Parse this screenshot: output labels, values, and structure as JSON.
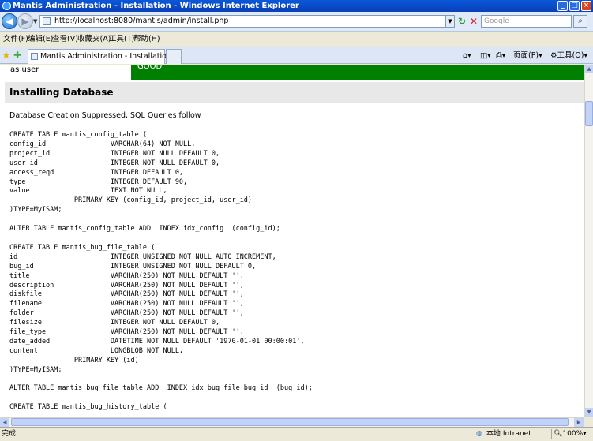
{
  "window": {
    "title": "Mantis Administration - Installation - Windows Internet Explorer"
  },
  "address": {
    "url": "http://localhost:8080/mantis/admin/install.php",
    "search_placeholder": "Google"
  },
  "menu": [
    "文件(F)",
    "编辑(E)",
    "查看(V)",
    "收藏夹(A)",
    "工具(T)",
    "帮助(H)"
  ],
  "tab": {
    "title": "Mantis Administration - Installation"
  },
  "command_bar": {
    "page": "页面(P)",
    "tools": "工具(O)"
  },
  "page": {
    "cut_label": "as user",
    "cut_status": "GOOD",
    "heading": "Installing Database",
    "note": "Database Creation Suppressed, SQL Queries follow",
    "sql_lines": [
      "CREATE TABLE mantis_config_table (",
      "config_id                VARCHAR(64) NOT NULL,",
      "project_id               INTEGER NOT NULL DEFAULT 0,",
      "user_id                  INTEGER NOT NULL DEFAULT 0,",
      "access_reqd              INTEGER DEFAULT 0,",
      "type                     INTEGER DEFAULT 90,",
      "value                    TEXT NOT NULL,",
      "                PRIMARY KEY (config_id, project_id, user_id)",
      ")TYPE=MyISAM;",
      "",
      "ALTER TABLE mantis_config_table ADD  INDEX idx_config  (config_id);",
      "",
      "CREATE TABLE mantis_bug_file_table (",
      "id                       INTEGER UNSIGNED NOT NULL AUTO_INCREMENT,",
      "bug_id                   INTEGER UNSIGNED NOT NULL DEFAULT 0,",
      "title                    VARCHAR(250) NOT NULL DEFAULT '',",
      "description              VARCHAR(250) NOT NULL DEFAULT '',",
      "diskfile                 VARCHAR(250) NOT NULL DEFAULT '',",
      "filename                 VARCHAR(250) NOT NULL DEFAULT '',",
      "folder                   VARCHAR(250) NOT NULL DEFAULT '',",
      "filesize                 INTEGER NOT NULL DEFAULT 0,",
      "file_type                VARCHAR(250) NOT NULL DEFAULT '',",
      "date_added               DATETIME NOT NULL DEFAULT '1970-01-01 00:00:01',",
      "content                  LONGBLOB NOT NULL,",
      "                PRIMARY KEY (id)",
      ")TYPE=MyISAM;",
      "",
      "ALTER TABLE mantis_bug_file_table ADD  INDEX idx_bug_file_bug_id  (bug_id);",
      "",
      "CREATE TABLE mantis_bug_history_table ("
    ]
  },
  "status": {
    "left": "完成",
    "zone": "本地 Intranet",
    "zoom": "100%"
  },
  "colors": {
    "good": "#008000",
    "titlebar": "#0a58d8",
    "heading_bg": "#e8e8e8"
  }
}
